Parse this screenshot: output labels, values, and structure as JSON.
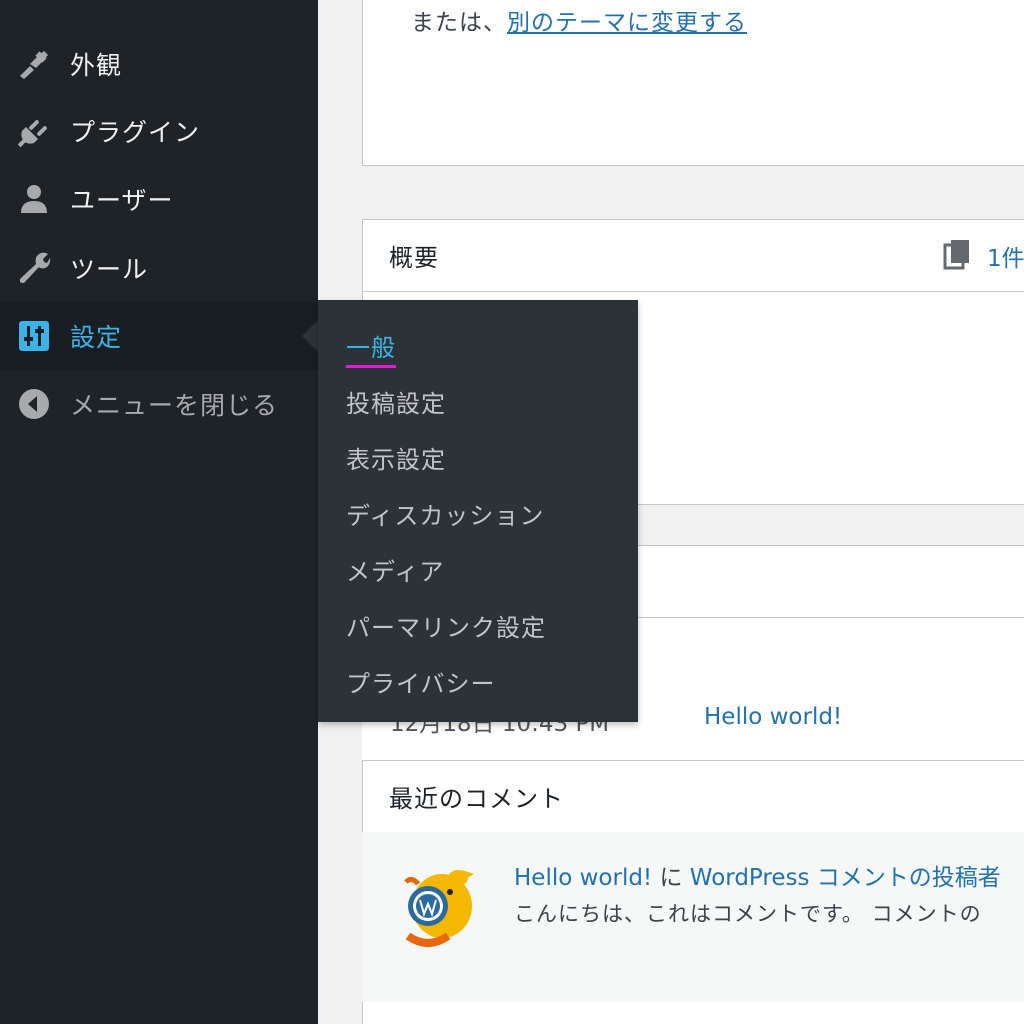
{
  "sidebar": {
    "items": [
      {
        "label": "外観",
        "icon": "paintbrush-icon"
      },
      {
        "label": "プラグイン",
        "icon": "plugin-icon"
      },
      {
        "label": "ユーザー",
        "icon": "user-icon"
      },
      {
        "label": "ツール",
        "icon": "wrench-icon"
      },
      {
        "label": "設定",
        "icon": "settings-icon",
        "current": true
      },
      {
        "label": "メニューを閉じる",
        "icon": "collapse-arrow-icon"
      }
    ]
  },
  "submenu": {
    "items": [
      {
        "label": "一般",
        "active": true
      },
      {
        "label": "投稿設定"
      },
      {
        "label": "表示設定"
      },
      {
        "label": "ディスカッション"
      },
      {
        "label": "メディア"
      },
      {
        "label": "パーマリンク設定"
      },
      {
        "label": "プライバシー"
      }
    ]
  },
  "theme_panel": {
    "prefix": "または、",
    "change_theme_link": "別のテーマに変更する"
  },
  "overview": {
    "title": "概要",
    "pages_count": "1件"
  },
  "activity": {
    "post_date": "12月18日 10:43 PM",
    "post_title": "Hello world!"
  },
  "recent_comments": {
    "title": "最近のコメント",
    "post_link": "Hello world!",
    "connector": " に ",
    "author_link": "WordPress コメントの投稿者",
    "excerpt": "こんにちは、これはコメントです。 コメントの"
  },
  "colors": {
    "sidebar_bg": "#1d2327",
    "submenu_bg": "#2c3338",
    "accent_blue": "#3db2e6",
    "link_blue": "#2271b1",
    "active_underline": "#e31bd4"
  }
}
